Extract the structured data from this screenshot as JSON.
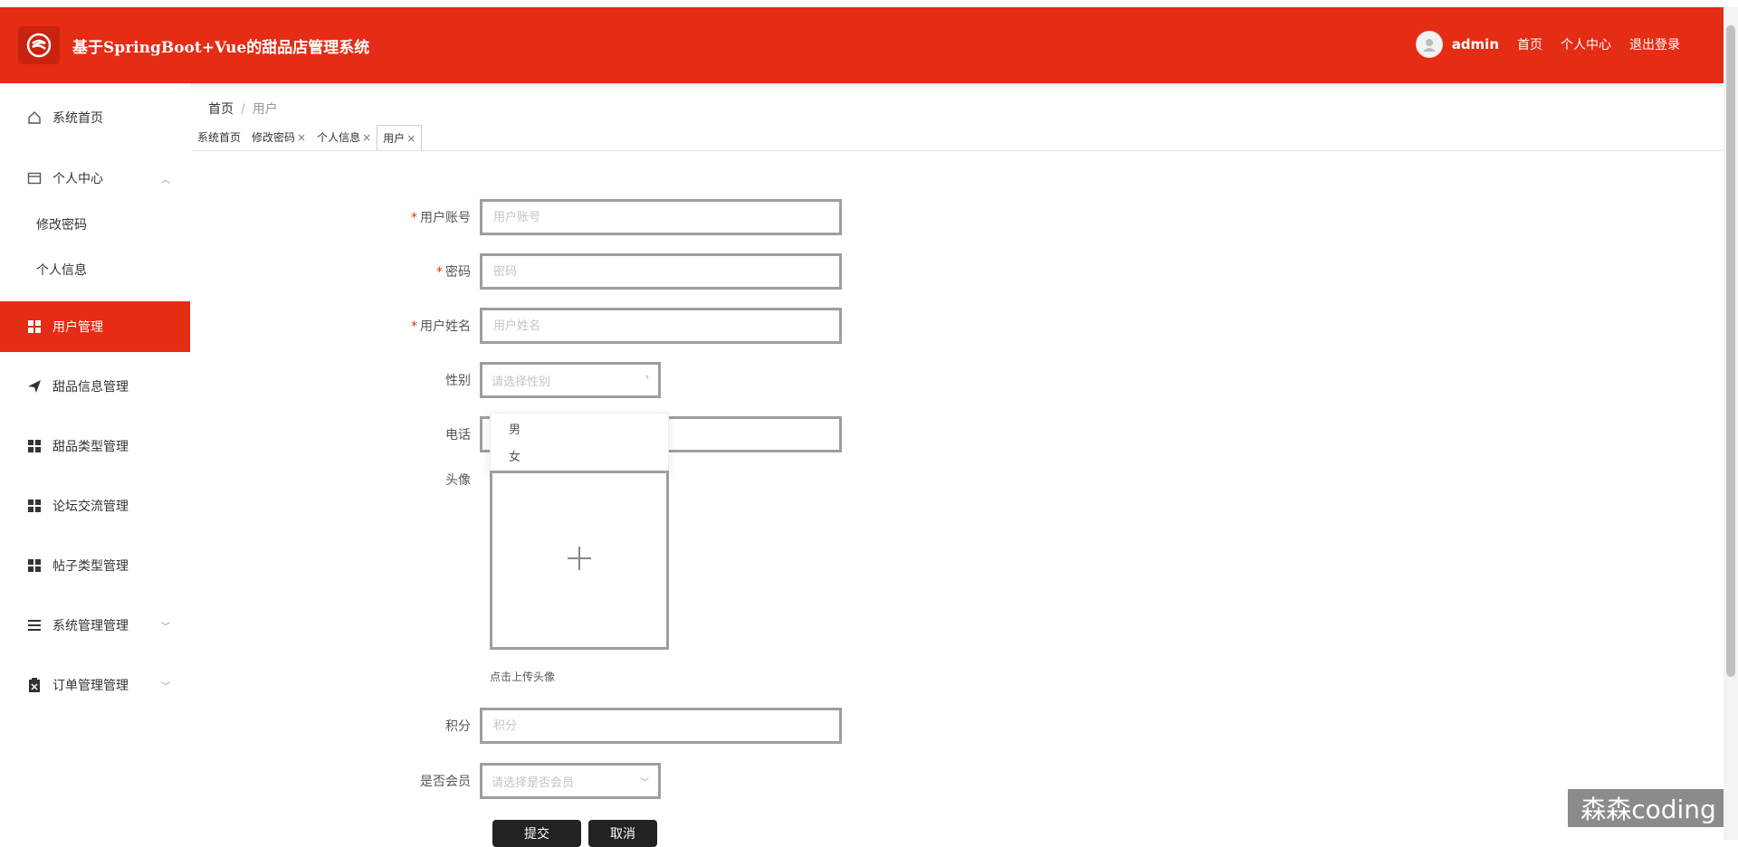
{
  "header": {
    "title": "基于SpringBoot+Vue的甜品店管理系统",
    "user": "admin",
    "nav": [
      "首页",
      "个人中心",
      "退出登录"
    ]
  },
  "sidebar": {
    "items": [
      {
        "label": "系统首页",
        "icon": "home-icon"
      },
      {
        "label": "个人中心",
        "icon": "card-icon"
      },
      {
        "label": "修改密码"
      },
      {
        "label": "个人信息"
      },
      {
        "label": "用户管理",
        "icon": "grid-icon"
      },
      {
        "label": "甜品信息管理",
        "icon": "send-icon"
      },
      {
        "label": "甜品类型管理",
        "icon": "grid-icon"
      },
      {
        "label": "论坛交流管理",
        "icon": "grid-icon"
      },
      {
        "label": "帖子类型管理",
        "icon": "grid-icon"
      },
      {
        "label": "系统管理管理",
        "icon": "list-icon"
      },
      {
        "label": "订单管理管理",
        "icon": "clipboard-icon"
      }
    ]
  },
  "breadcrumb": {
    "home": "首页",
    "current": "用户"
  },
  "tabs": [
    {
      "label": "系统首页"
    },
    {
      "label": "修改密码",
      "close": "×"
    },
    {
      "label": "个人信息",
      "close": "×"
    },
    {
      "label": "用户",
      "close": "×"
    }
  ],
  "form": {
    "account": {
      "label": "用户账号",
      "placeholder": "用户账号"
    },
    "password": {
      "label": "密码",
      "placeholder": "密码"
    },
    "name": {
      "label": "用户姓名",
      "placeholder": "用户姓名"
    },
    "gender": {
      "label": "性别",
      "placeholder": "请选择性别",
      "options": [
        "男",
        "女"
      ]
    },
    "phone": {
      "label": "电话"
    },
    "avatar": {
      "label": "头像",
      "tip": "点击上传头像"
    },
    "points": {
      "label": "积分",
      "placeholder": "积分"
    },
    "member": {
      "label": "是否会员",
      "placeholder": "请选择是否会员"
    },
    "submit": "提交",
    "cancel": "取消"
  },
  "watermark": "森森coding",
  "colors": {
    "brand": "#e52c15",
    "required": "#e52c15"
  }
}
